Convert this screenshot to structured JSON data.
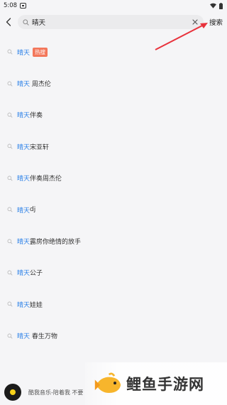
{
  "status_bar": {
    "time": "5:08"
  },
  "search": {
    "query": "晴天",
    "button_label": "搜索"
  },
  "suggestions": [
    {
      "keyword": "晴天",
      "suffix": "",
      "badge": "热搜"
    },
    {
      "keyword": "晴天",
      "suffix": " 周杰伦",
      "badge": ""
    },
    {
      "keyword": "晴天",
      "suffix": "伴奏",
      "badge": ""
    },
    {
      "keyword": "晴天",
      "suffix": "宋亚轩",
      "badge": ""
    },
    {
      "keyword": "晴天",
      "suffix": "伴奏周杰伦",
      "badge": ""
    },
    {
      "keyword": "晴天",
      "suffix": "dj",
      "badge": ""
    },
    {
      "keyword": "晴天",
      "suffix": "露房你绝情的放手",
      "badge": ""
    },
    {
      "keyword": "晴天",
      "suffix": "公子",
      "badge": ""
    },
    {
      "keyword": "晴天",
      "suffix": "娃娃",
      "badge": ""
    },
    {
      "keyword": "晴天",
      "suffix": " 春生万物",
      "badge": ""
    }
  ],
  "player": {
    "text": "酷我音乐-陪着我 不要"
  },
  "watermark": {
    "text": "鲤鱼手游网"
  },
  "colors": {
    "highlight": "#2f83e8",
    "badge": "#f3775b",
    "arrow": "#e8323c"
  }
}
